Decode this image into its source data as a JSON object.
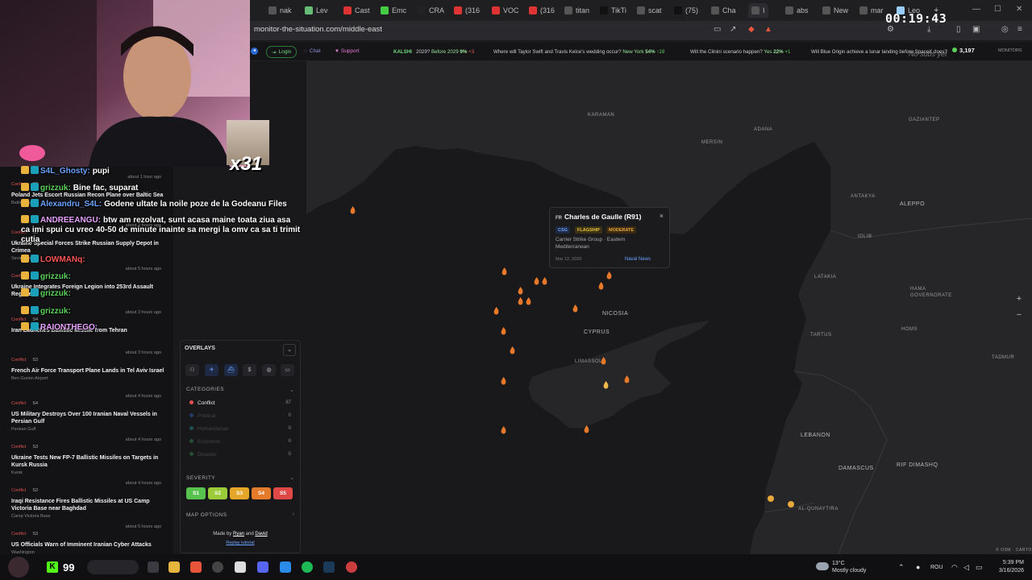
{
  "browser": {
    "tabs": [
      "nak",
      "Lev",
      "Cast",
      "Emc",
      "CRA",
      "(316",
      "VOC",
      "(316",
      "titan",
      "TikTi",
      "scat",
      "(75)",
      "Cha",
      "I",
      "abs",
      "New",
      "mar",
      "Leo"
    ],
    "url": "monitor-the-situation.com/middle-east"
  },
  "stream": {
    "clock": "00:19:43",
    "combo": "x31",
    "chat": [
      {
        "user": "S4L_Ghosty:",
        "msg": "pupi"
      },
      {
        "user": "grizzuk:",
        "msg": "Bine fac, suparat"
      },
      {
        "user": "Alexandru_S4L:",
        "msg": "Godene ultate la noile poze de la Godeanu Files"
      },
      {
        "user": "ANDREEANGU:",
        "msg": "btw am rezolvat, sunt acasa maine toata ziua asa ca imi spui cu vreo 40-50 de minute inainte sa mergi la omv ca sa ti trimit cutia"
      },
      {
        "user": "LOWMANq:",
        "msg": ""
      },
      {
        "user": "grizzuk:",
        "msg": ""
      },
      {
        "user": "grizzuk:",
        "msg": ""
      },
      {
        "user": "grizzuk:",
        "msg": ""
      },
      {
        "user": "RAIONTHEGO:",
        "msg": ""
      }
    ]
  },
  "site": {
    "login": "Login",
    "chat": "Chat",
    "support": "Support",
    "kalshi": "KALSHI",
    "ticker": [
      {
        "q": "2029?",
        "a": "Before 2029",
        "pct": "9%",
        "chg": "+3"
      },
      {
        "q": "Where will Taylor Swift and Travis Kelce's wedding occur?",
        "a": "New York",
        "pct": "54%",
        "chg": "↑19"
      },
      {
        "q": "Will the Clinini scenario happen?",
        "a": "Yes",
        "pct": "22%",
        "chg": "+1"
      },
      {
        "q": "Will Blue Origin achieve a lunar landing before SpaceX does?",
        "a": "",
        "pct": "",
        "chg": ""
      }
    ],
    "monitors_count": "3,197",
    "monitors_label": "MONITORS",
    "overlay_text": "No subs yet"
  },
  "map": {
    "labels": [
      "KARAMAN",
      "MERSIN",
      "ADANA",
      "GAZIANTEP",
      "ALEPPO",
      "IDLIB",
      "HAMA GOVERNORATE",
      "HOMS",
      "TADMUR",
      "NICOSIA",
      "CYPRUS",
      "LIMASSOL",
      "LEBANON",
      "DAMASCUS",
      "RIF DIMASHQ",
      "AL-QUNAYTIRA",
      "ANTAKYA",
      "LATAKIA",
      "TARTUS"
    ],
    "attribution": "© OSM · CARTO",
    "popup": {
      "flag": "FR",
      "title": "Charles de Gaulle (R91)",
      "badges": [
        "CSG",
        "FLAGSHIP",
        "MODERATE"
      ],
      "desc": "Carrier Strike Group · Eastern Mediterranean",
      "date": "Mar 12, 2026",
      "source": "Naval News"
    }
  },
  "feed": [
    {
      "cat": "Conflict",
      "sev": "S3",
      "age": "about 1 hour ago",
      "headline": "Poland Jets Escort Russian Recon Plane over Baltic Sea",
      "loc": "Baltic Sea"
    },
    {
      "cat": "Conflict",
      "sev": "S3",
      "age": "about 3 hours ago",
      "headline": "Ukraine Special Forces Strike Russian Supply Depot in Crimea",
      "loc": "Sevastopol"
    },
    {
      "cat": "Conflict",
      "sev": "S3",
      "age": "about 5 hours ago",
      "headline": "Ukraine Integrates Foreign Legion into 253rd Assault Regiment",
      "loc": ""
    },
    {
      "cat": "Conflict",
      "sev": "S4",
      "age": "about 3 hours ago",
      "headline": "Iran Launches Ballistic Missile from Tehran",
      "loc": ""
    },
    {
      "cat": "Conflict",
      "sev": "S3",
      "age": "about 3 hours ago",
      "headline": "French Air Force Transport Plane Lands in Tel Aviv Israel",
      "loc": "Ben Gurion Airport"
    },
    {
      "cat": "Conflict",
      "sev": "S4",
      "age": "about 4 hours ago",
      "headline": "US Military Destroys Over 100 Iranian Naval Vessels in Persian Gulf",
      "loc": "Persian Gulf"
    },
    {
      "cat": "Conflict",
      "sev": "S3",
      "age": "about 4 hours ago",
      "headline": "Ukraine Tests New FP-7 Ballistic Missiles on Targets in Kursk Russia",
      "loc": "Kursk"
    },
    {
      "cat": "Conflict",
      "sev": "S3",
      "age": "about 4 hours ago",
      "headline": "Iraqi Resistance Fires Ballistic Missiles at US Camp Victoria Base near Baghdad",
      "loc": "Camp Victoria Base"
    },
    {
      "cat": "Conflict",
      "sev": "S3",
      "age": "about 5 hours ago",
      "headline": "US Officials Warn of Imminent Iranian Cyber Attacks",
      "loc": "Washington"
    }
  ],
  "panel": {
    "title": "OVERLAYS",
    "categories_label": "CATEGORIES",
    "categories": [
      {
        "name": "Conflict",
        "count": "87",
        "color": "#e35252"
      },
      {
        "name": "Political",
        "count": "0",
        "color": "#3b6fd6"
      },
      {
        "name": "Humanitarian",
        "count": "0",
        "color": "#2aa3a3"
      },
      {
        "name": "Economic",
        "count": "0",
        "color": "#3aa35a"
      },
      {
        "name": "Disaster",
        "count": "0",
        "color": "#3aa35a"
      }
    ],
    "severity_label": "SEVERITY",
    "severity": [
      {
        "label": "S1",
        "color": "#58c24f"
      },
      {
        "label": "S2",
        "color": "#9ccb3a"
      },
      {
        "label": "S3",
        "color": "#e4a72a"
      },
      {
        "label": "S4",
        "color": "#e47b2a"
      },
      {
        "label": "S5",
        "color": "#e04848"
      }
    ],
    "map_options": "MAP OPTIONS",
    "credit_prefix": "Made by",
    "credit_a": "Ryan",
    "credit_and": "and",
    "credit_b": "David",
    "replay": "Replay tutorial"
  },
  "taskbar": {
    "counter": "99",
    "weather_temp": "13°C",
    "weather_desc": "Mostly cloudy",
    "lang": "ROU",
    "time": "5:39 PM",
    "date": "3/16/2026"
  }
}
